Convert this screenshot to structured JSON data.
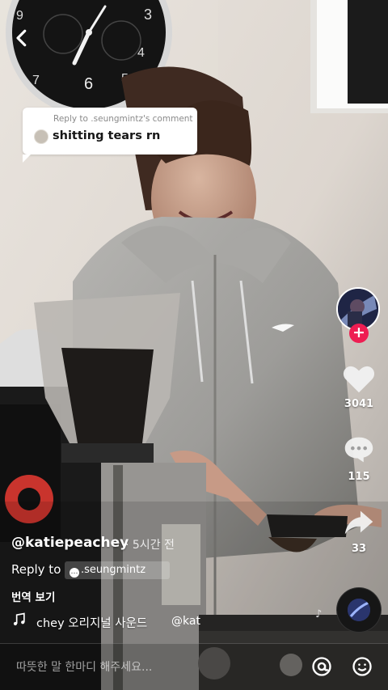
{
  "reply_bubble": {
    "subtitle": "Reply to .seungmintz's comment",
    "text": "shitting tears rn"
  },
  "rail": {
    "likes": "3041",
    "comments": "115",
    "shares": "33"
  },
  "post": {
    "username": "@katiepeachey",
    "time": "· 5시간 전",
    "reply_to_label": "Reply to",
    "reply_to_user": ".seungmintz",
    "translate": "번역 보기",
    "sound": "chey 오리지널 사운드",
    "sound_author": "@kat"
  },
  "comment_bar": {
    "placeholder": "따뜻한 말 한마디 해주세요..."
  },
  "colors": {
    "accent": "#ee1d52",
    "text": "#ffffff"
  },
  "icons": [
    "back-arrow-icon",
    "heart-icon",
    "comment-icon",
    "share-icon",
    "music-note-icon",
    "at-icon",
    "emoji-icon"
  ]
}
